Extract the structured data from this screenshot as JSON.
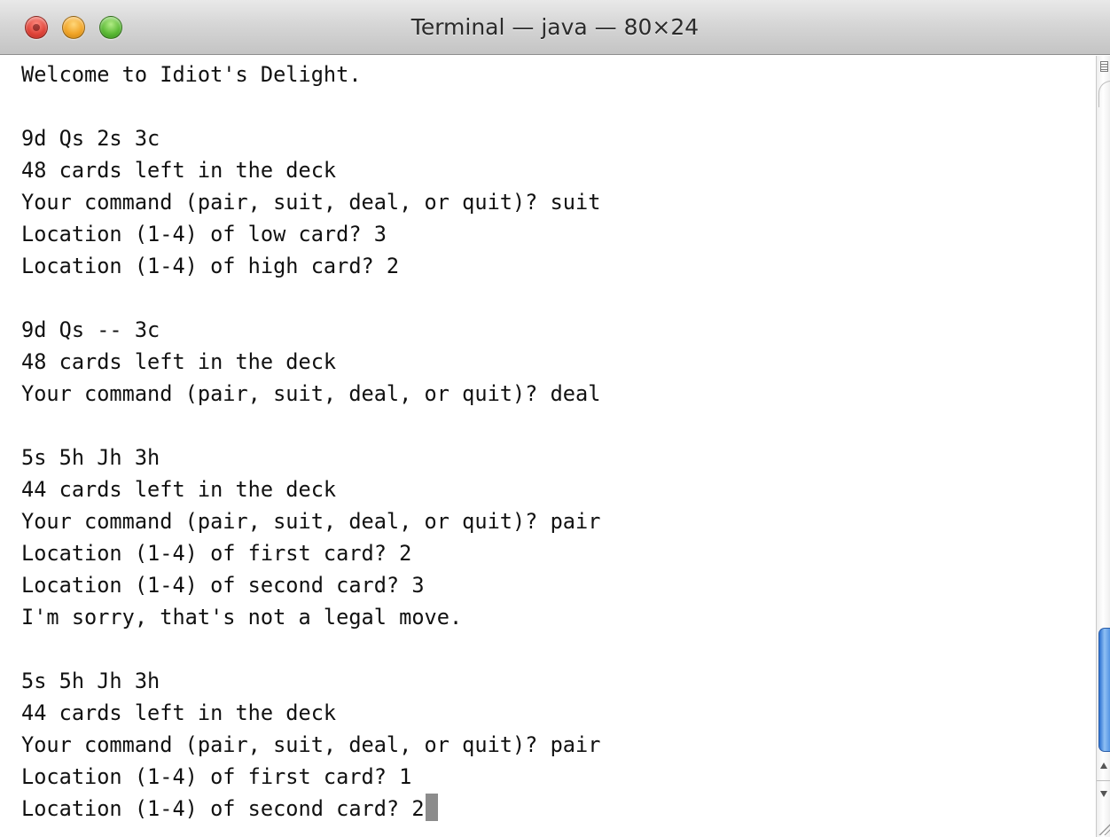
{
  "window": {
    "title": "Terminal — java — 80×24"
  },
  "terminal": {
    "lines": [
      "Welcome to Idiot's Delight.",
      "",
      "9d Qs 2s 3c",
      "48 cards left in the deck",
      "Your command (pair, suit, deal, or quit)? suit",
      "Location (1-4) of low card? 3",
      "Location (1-4) of high card? 2",
      "",
      "9d Qs -- 3c",
      "48 cards left in the deck",
      "Your command (pair, suit, deal, or quit)? deal",
      "",
      "5s 5h Jh 3h",
      "44 cards left in the deck",
      "Your command (pair, suit, deal, or quit)? pair",
      "Location (1-4) of first card? 2",
      "Location (1-4) of second card? 3",
      "I'm sorry, that's not a legal move.",
      "",
      "5s 5h Jh 3h",
      "44 cards left in the deck",
      "Your command (pair, suit, deal, or quit)? pair",
      "Location (1-4) of first card? 1",
      "Location (1-4) of second card? 2"
    ]
  },
  "icons": {
    "close": "close-button-icon",
    "minimize": "minimize-button-icon",
    "zoom": "zoom-button-icon",
    "cursor": "text-cursor-block",
    "split": "split-pane-icon",
    "resize": "resize-grip-icon"
  },
  "colors": {
    "close": "#e0453a",
    "minimize": "#f1a528",
    "zoom": "#5cba36",
    "scroll_thumb": "#4a8de0",
    "text": "#111111",
    "background": "#ffffff"
  }
}
